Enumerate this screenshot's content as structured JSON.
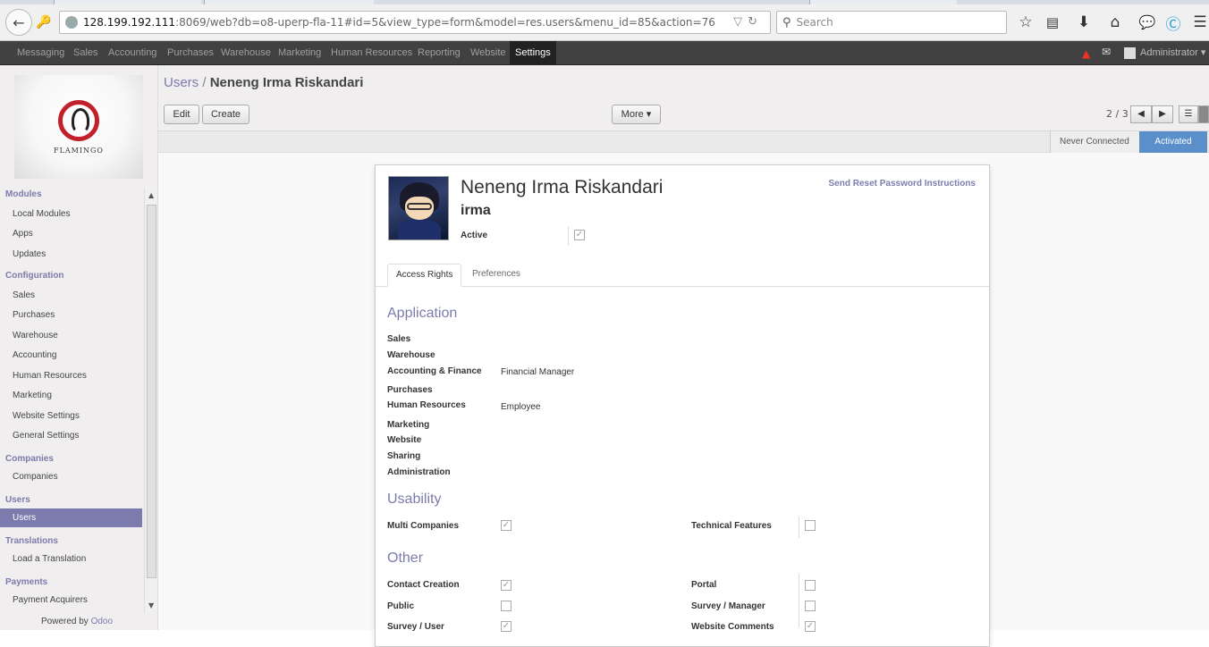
{
  "browser": {
    "url_host": "128.199.192.111",
    "url_rest": ":8069/web?db=o8-uperp-fla-11#id=5&view_type=form&model=res.users&menu_id=85&action=76",
    "search_placeholder": "Search",
    "icons": [
      "back-icon",
      "identity-icon",
      "star-icon",
      "bookmarks-icon",
      "download-icon",
      "home-icon",
      "chat-icon",
      "skype-icon",
      "menu-icon"
    ]
  },
  "topmenu": {
    "items": [
      "Messaging",
      "Sales",
      "Accounting",
      "Purchases",
      "Warehouse",
      "Marketing",
      "Human Resources",
      "Reporting",
      "Website",
      "Settings"
    ],
    "active": "Settings",
    "user": "Administrator"
  },
  "sidebar": {
    "logo_text": "FLAMINGO",
    "sections": [
      {
        "title": "Modules",
        "items": [
          "Local Modules",
          "Apps",
          "Updates"
        ]
      },
      {
        "title": "Configuration",
        "items": [
          "Sales",
          "Purchases",
          "Warehouse",
          "Accounting",
          "Human Resources",
          "Marketing",
          "Website Settings",
          "General Settings"
        ]
      },
      {
        "title": "Companies",
        "items": [
          "Companies"
        ]
      },
      {
        "title": "Users",
        "items": [
          "Users"
        ]
      },
      {
        "title": "Translations",
        "items": [
          "Load a Translation"
        ]
      },
      {
        "title": "Payments",
        "items": [
          "Payment Acquirers"
        ]
      }
    ],
    "selected_item": "Users",
    "powered_by": "Powered by",
    "powered_brand": "Odoo"
  },
  "header": {
    "breadcrumb_parent": "Users",
    "breadcrumb_sep": "/",
    "breadcrumb_current": "Neneng Irma Riskandari",
    "edit_label": "Edit",
    "create_label": "Create",
    "more_label": "More ▾",
    "pager": "2 / 3"
  },
  "status": {
    "stages": [
      "Never Connected",
      "Activated"
    ],
    "active_stage": "Activated"
  },
  "form": {
    "name": "Neneng Irma Riskandari",
    "login": "irma",
    "reset_link": "Send Reset Password Instructions",
    "active_label": "Active",
    "active_checked": true,
    "tabs": [
      "Access Rights",
      "Preferences"
    ],
    "active_tab": "Access Rights",
    "application_title": "Application",
    "application": [
      {
        "label": "Sales",
        "value": ""
      },
      {
        "label": "Warehouse",
        "value": ""
      },
      {
        "label": "Accounting & Finance",
        "value": "Financial Manager"
      },
      {
        "label": "Purchases",
        "value": ""
      },
      {
        "label": "Human Resources",
        "value": "Employee"
      },
      {
        "label": "Marketing",
        "value": ""
      },
      {
        "label": "Website",
        "value": ""
      },
      {
        "label": "Sharing",
        "value": ""
      },
      {
        "label": "Administration",
        "value": ""
      }
    ],
    "usability_title": "Usability",
    "usability": [
      {
        "label": "Multi Companies",
        "checked": true
      },
      {
        "label": "Technical Features",
        "checked": false
      }
    ],
    "other_title": "Other",
    "other": [
      {
        "label": "Contact Creation",
        "checked": true
      },
      {
        "label": "Portal",
        "checked": false
      },
      {
        "label": "Public",
        "checked": false
      },
      {
        "label": "Survey / Manager",
        "checked": false
      },
      {
        "label": "Survey / User",
        "checked": true
      },
      {
        "label": "Website Comments",
        "checked": true
      }
    ]
  }
}
